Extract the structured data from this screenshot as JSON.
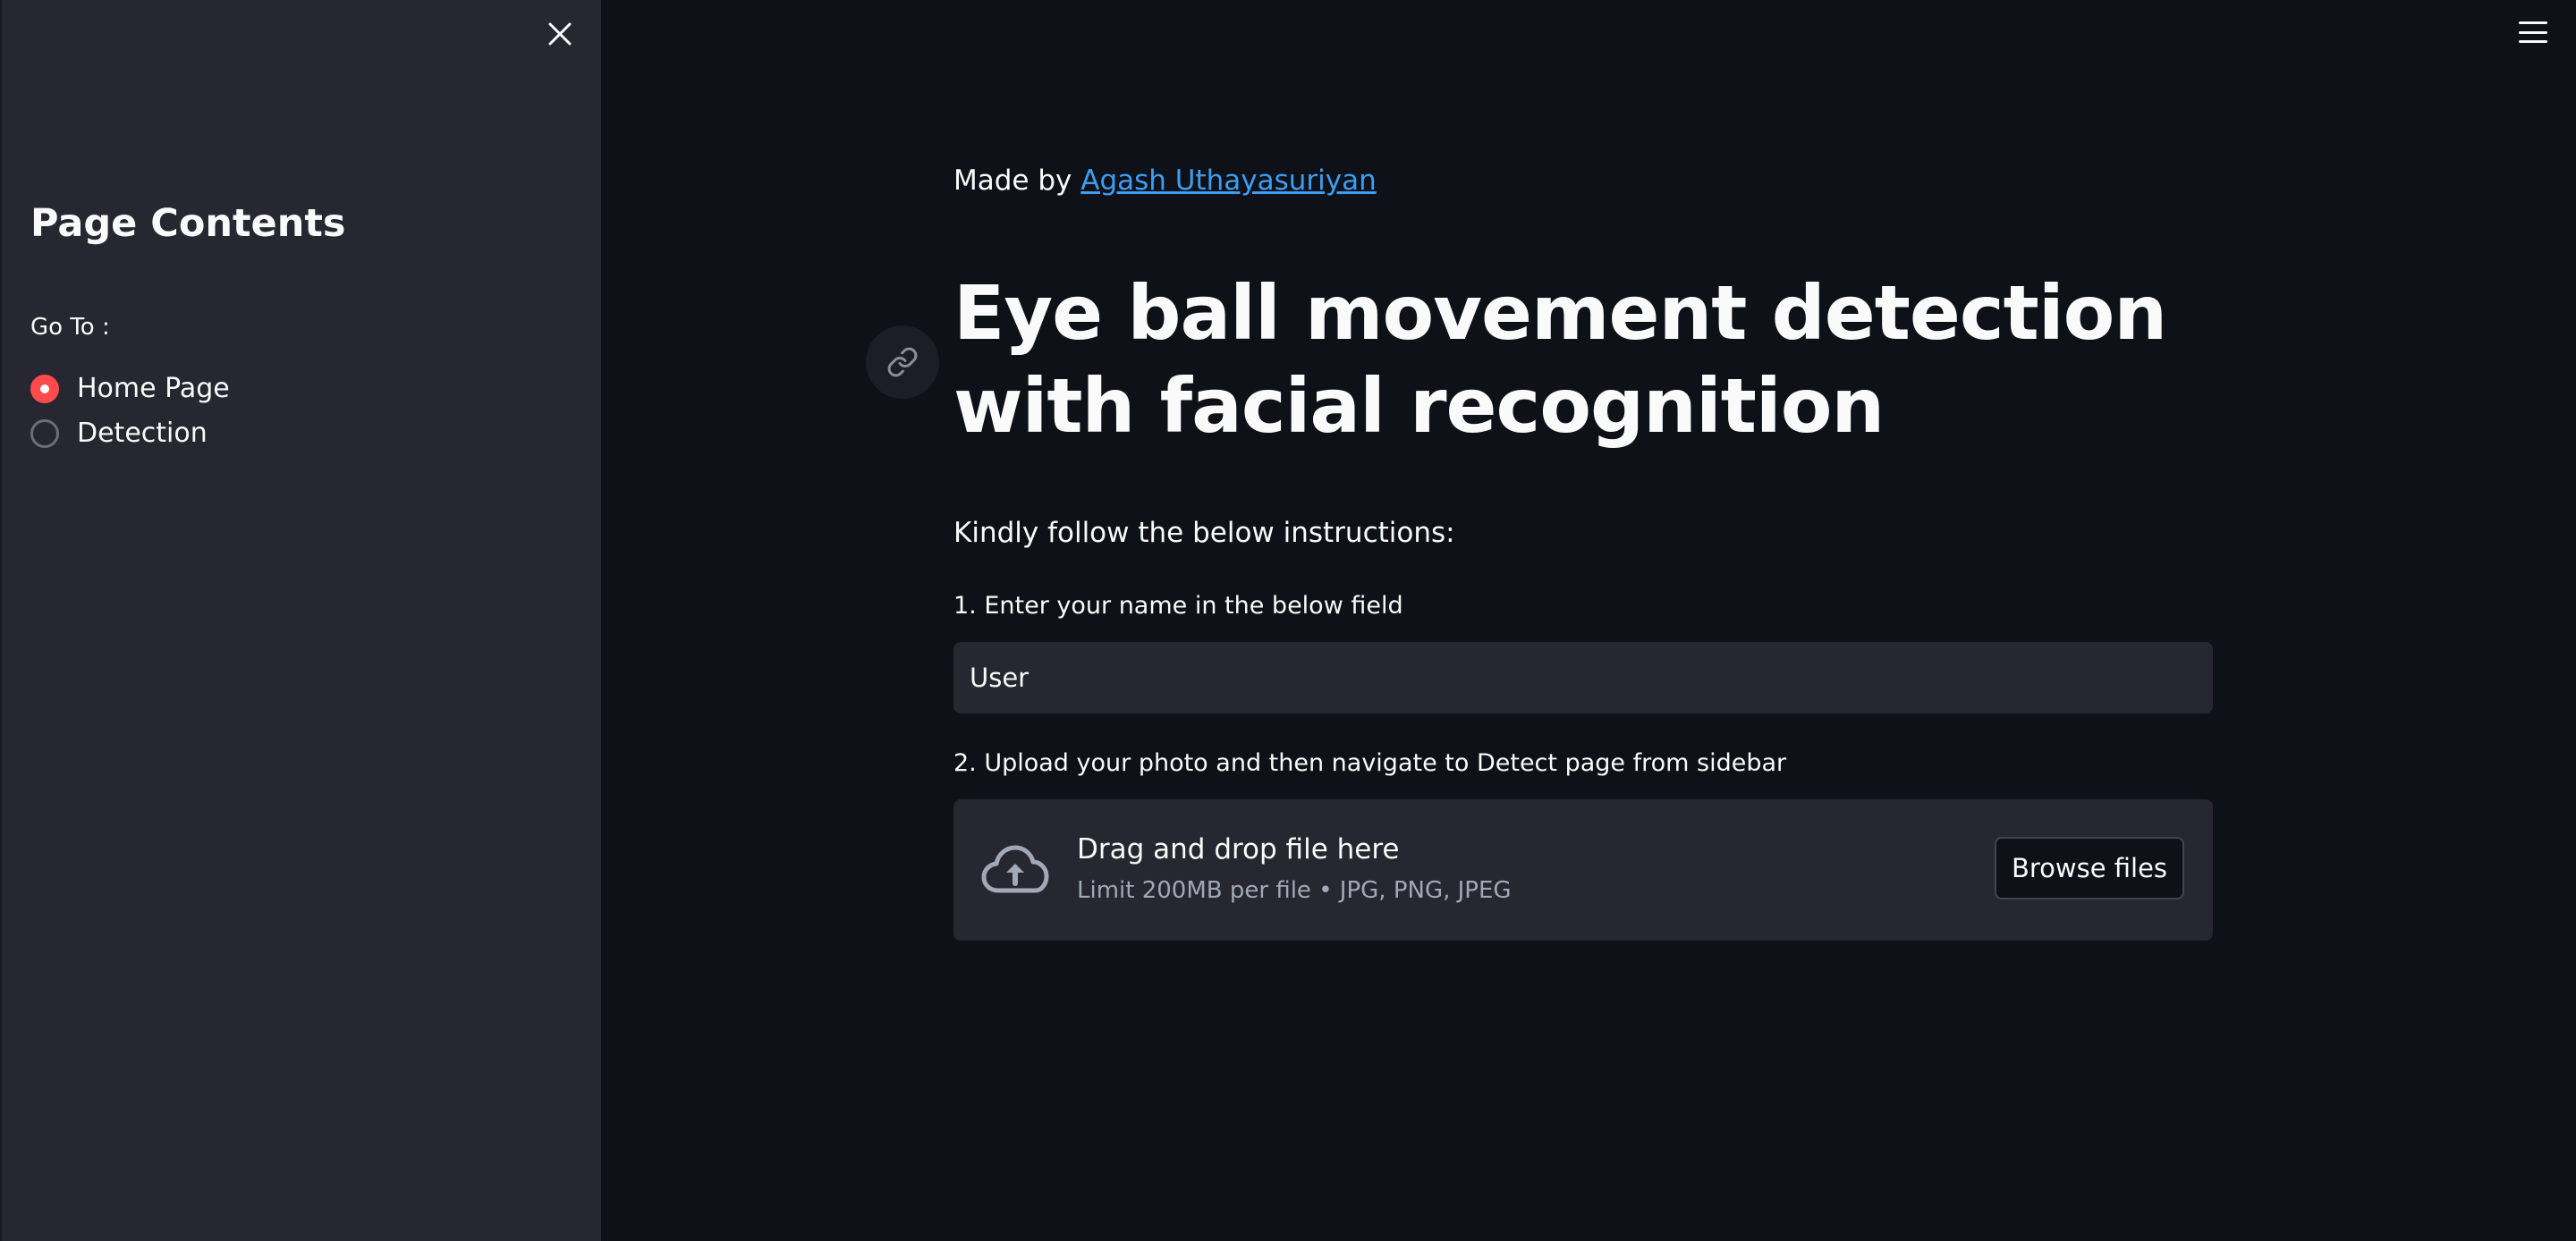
{
  "sidebar": {
    "title": "Page Contents",
    "goto_label": "Go To :",
    "options": [
      {
        "label": "Home Page",
        "selected": true
      },
      {
        "label": "Detection",
        "selected": false
      }
    ]
  },
  "main": {
    "made_by_prefix": "Made by ",
    "author_link": "Agash Uthayasuriyan",
    "title": "Eye ball movement detection with facial recognition",
    "instructions": "Kindly follow the below instructions:",
    "step1_label": "1. Enter your name in the below field",
    "name_value": "User",
    "step2_label": "2. Upload your photo and then navigate to Detect page from sidebar",
    "uploader": {
      "title": "Drag and drop file here",
      "limit_text": "Limit 200MB per file • JPG, PNG, JPEG",
      "button_label": "Browse files"
    }
  },
  "colors": {
    "background": "#0e1117",
    "sidebar": "#262730",
    "accent": "#ff4b4b",
    "link": "#3d9df3"
  },
  "icons": {
    "close": "close-icon",
    "menu": "hamburger-menu-icon",
    "anchor": "link-icon",
    "upload": "cloud-upload-icon"
  }
}
